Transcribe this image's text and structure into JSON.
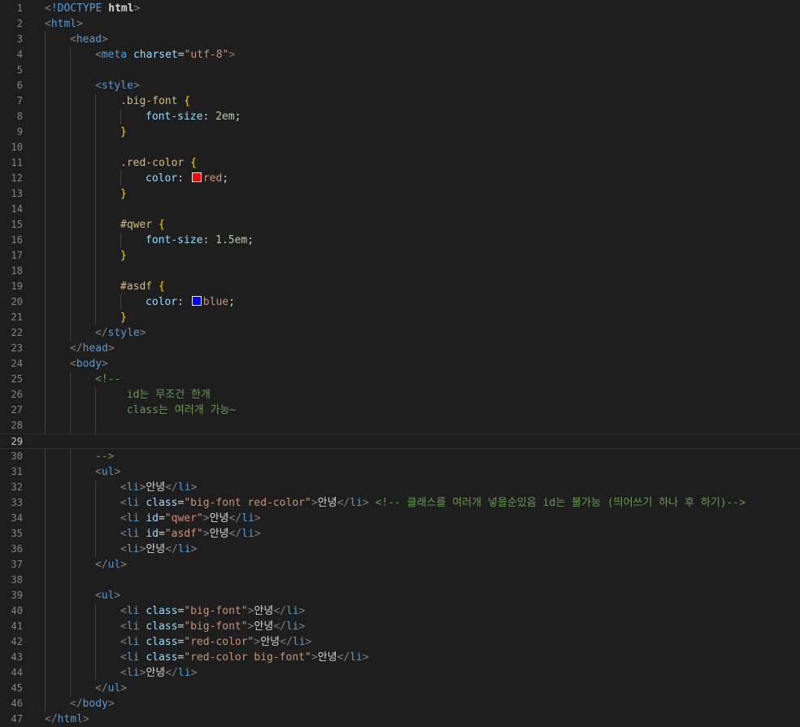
{
  "editor": {
    "current_line": 29,
    "colors": {
      "background": "#1e1e1e",
      "tag": "#569cd6",
      "attribute": "#9cdcfe",
      "string": "#ce9178",
      "comment": "#6a9955",
      "selector": "#d7ba7d",
      "brace": "#ffd700",
      "number": "#b5cea8",
      "swatch_red": "#ff0000",
      "swatch_blue": "#0000ff"
    },
    "lines": [
      {
        "n": "1",
        "indent": 0,
        "tokens": [
          [
            "punc",
            "<"
          ],
          [
            "tag",
            "!DOCTYPE "
          ],
          [
            "kw",
            "html"
          ],
          [
            "punc",
            ">"
          ]
        ]
      },
      {
        "n": "2",
        "indent": 0,
        "tokens": [
          [
            "punc",
            "<"
          ],
          [
            "tag",
            "html"
          ],
          [
            "punc",
            ">"
          ]
        ]
      },
      {
        "n": "3",
        "indent": 1,
        "tokens": [
          [
            "punc",
            "<"
          ],
          [
            "tag",
            "head"
          ],
          [
            "punc",
            ">"
          ]
        ]
      },
      {
        "n": "4",
        "indent": 2,
        "tokens": [
          [
            "punc",
            "<"
          ],
          [
            "tag",
            "meta "
          ],
          [
            "attr",
            "charset"
          ],
          [
            "text",
            "="
          ],
          [
            "str",
            "\"utf-8\""
          ],
          [
            "punc",
            ">"
          ]
        ]
      },
      {
        "n": "5",
        "indent": 2,
        "tokens": []
      },
      {
        "n": "6",
        "indent": 2,
        "tokens": [
          [
            "punc",
            "<"
          ],
          [
            "tag",
            "style"
          ],
          [
            "punc",
            ">"
          ]
        ]
      },
      {
        "n": "7",
        "indent": 3,
        "tokens": [
          [
            "sel",
            ".big-font "
          ],
          [
            "brace",
            "{"
          ]
        ]
      },
      {
        "n": "8",
        "indent": 4,
        "tokens": [
          [
            "prop",
            "font-size"
          ],
          [
            "text",
            ": "
          ],
          [
            "num",
            "2em"
          ],
          [
            "text",
            ";"
          ]
        ]
      },
      {
        "n": "9",
        "indent": 3,
        "tokens": [
          [
            "brace",
            "}"
          ]
        ]
      },
      {
        "n": "10",
        "indent": 3,
        "tokens": []
      },
      {
        "n": "11",
        "indent": 3,
        "tokens": [
          [
            "sel",
            ".red-color "
          ],
          [
            "brace",
            "{"
          ]
        ]
      },
      {
        "n": "12",
        "indent": 4,
        "tokens": [
          [
            "prop",
            "color"
          ],
          [
            "text",
            ": "
          ],
          [
            "swatch",
            "#ff0000"
          ],
          [
            "val",
            "red"
          ],
          [
            "text",
            ";"
          ]
        ]
      },
      {
        "n": "13",
        "indent": 3,
        "tokens": [
          [
            "brace",
            "}"
          ]
        ]
      },
      {
        "n": "14",
        "indent": 3,
        "tokens": []
      },
      {
        "n": "15",
        "indent": 3,
        "tokens": [
          [
            "sel",
            "#qwer "
          ],
          [
            "brace",
            "{"
          ]
        ]
      },
      {
        "n": "16",
        "indent": 4,
        "tokens": [
          [
            "prop",
            "font-size"
          ],
          [
            "text",
            ": "
          ],
          [
            "num",
            "1.5em"
          ],
          [
            "text",
            ";"
          ]
        ]
      },
      {
        "n": "17",
        "indent": 3,
        "tokens": [
          [
            "brace",
            "}"
          ]
        ]
      },
      {
        "n": "18",
        "indent": 3,
        "tokens": []
      },
      {
        "n": "19",
        "indent": 3,
        "tokens": [
          [
            "sel",
            "#asdf "
          ],
          [
            "brace",
            "{"
          ]
        ]
      },
      {
        "n": "20",
        "indent": 4,
        "tokens": [
          [
            "prop",
            "color"
          ],
          [
            "text",
            ": "
          ],
          [
            "swatch",
            "#0000ff"
          ],
          [
            "val",
            "blue"
          ],
          [
            "text",
            ";"
          ]
        ]
      },
      {
        "n": "21",
        "indent": 3,
        "tokens": [
          [
            "brace",
            "}"
          ]
        ]
      },
      {
        "n": "22",
        "indent": 2,
        "tokens": [
          [
            "punc",
            "</"
          ],
          [
            "tag",
            "style"
          ],
          [
            "punc",
            ">"
          ]
        ]
      },
      {
        "n": "23",
        "indent": 1,
        "tokens": [
          [
            "punc",
            "</"
          ],
          [
            "tag",
            "head"
          ],
          [
            "punc",
            ">"
          ]
        ]
      },
      {
        "n": "24",
        "indent": 1,
        "tokens": [
          [
            "punc",
            "<"
          ],
          [
            "tag",
            "body"
          ],
          [
            "punc",
            ">"
          ]
        ]
      },
      {
        "n": "25",
        "indent": 2,
        "tokens": [
          [
            "com",
            "<!--"
          ]
        ]
      },
      {
        "n": "26",
        "indent": 3,
        "tokens": [
          [
            "com",
            " id는 무조건 한개"
          ]
        ]
      },
      {
        "n": "27",
        "indent": 3,
        "tokens": [
          [
            "com",
            " class는 여러개 가능~"
          ]
        ]
      },
      {
        "n": "28",
        "indent": 3,
        "tokens": []
      },
      {
        "n": "29",
        "indent": 0,
        "tokens": []
      },
      {
        "n": "30",
        "indent": 2,
        "tokens": [
          [
            "com",
            "-->"
          ]
        ]
      },
      {
        "n": "31",
        "indent": 2,
        "tokens": [
          [
            "punc",
            "<"
          ],
          [
            "tag",
            "ul"
          ],
          [
            "punc",
            ">"
          ]
        ]
      },
      {
        "n": "32",
        "indent": 3,
        "tokens": [
          [
            "punc",
            "<"
          ],
          [
            "tag",
            "li"
          ],
          [
            "punc",
            ">"
          ],
          [
            "text",
            "안녕"
          ],
          [
            "punc",
            "</"
          ],
          [
            "tag",
            "li"
          ],
          [
            "punc",
            ">"
          ]
        ]
      },
      {
        "n": "33",
        "indent": 3,
        "tokens": [
          [
            "punc",
            "<"
          ],
          [
            "tag",
            "li "
          ],
          [
            "attr",
            "class"
          ],
          [
            "text",
            "="
          ],
          [
            "str",
            "\"big-font red-color\""
          ],
          [
            "punc",
            ">"
          ],
          [
            "text",
            "안녕"
          ],
          [
            "punc",
            "</"
          ],
          [
            "tag",
            "li"
          ],
          [
            "punc",
            "> "
          ],
          [
            "com",
            "<!-- 클래스를 여러개 넣을순있음 id는 불가능 (띄어쓰기 하나 후 하기)-->"
          ]
        ]
      },
      {
        "n": "34",
        "indent": 3,
        "tokens": [
          [
            "punc",
            "<"
          ],
          [
            "tag",
            "li "
          ],
          [
            "attr",
            "id"
          ],
          [
            "text",
            "="
          ],
          [
            "str",
            "\"qwer\""
          ],
          [
            "punc",
            ">"
          ],
          [
            "text",
            "안녕"
          ],
          [
            "punc",
            "</"
          ],
          [
            "tag",
            "li"
          ],
          [
            "punc",
            ">"
          ]
        ]
      },
      {
        "n": "35",
        "indent": 3,
        "tokens": [
          [
            "punc",
            "<"
          ],
          [
            "tag",
            "li "
          ],
          [
            "attr",
            "id"
          ],
          [
            "text",
            "="
          ],
          [
            "str",
            "\"asdf\""
          ],
          [
            "punc",
            ">"
          ],
          [
            "text",
            "안녕"
          ],
          [
            "punc",
            "</"
          ],
          [
            "tag",
            "li"
          ],
          [
            "punc",
            ">"
          ]
        ]
      },
      {
        "n": "36",
        "indent": 3,
        "tokens": [
          [
            "punc",
            "<"
          ],
          [
            "tag",
            "li"
          ],
          [
            "punc",
            ">"
          ],
          [
            "text",
            "안녕"
          ],
          [
            "punc",
            "</"
          ],
          [
            "tag",
            "li"
          ],
          [
            "punc",
            ">"
          ]
        ]
      },
      {
        "n": "37",
        "indent": 2,
        "tokens": [
          [
            "punc",
            "</"
          ],
          [
            "tag",
            "ul"
          ],
          [
            "punc",
            ">"
          ]
        ]
      },
      {
        "n": "38",
        "indent": 2,
        "tokens": []
      },
      {
        "n": "39",
        "indent": 2,
        "tokens": [
          [
            "punc",
            "<"
          ],
          [
            "tag",
            "ul"
          ],
          [
            "punc",
            ">"
          ]
        ]
      },
      {
        "n": "40",
        "indent": 3,
        "tokens": [
          [
            "punc",
            "<"
          ],
          [
            "tag",
            "li "
          ],
          [
            "attr",
            "class"
          ],
          [
            "text",
            "="
          ],
          [
            "str",
            "\"big-font\""
          ],
          [
            "punc",
            ">"
          ],
          [
            "text",
            "안녕"
          ],
          [
            "punc",
            "</"
          ],
          [
            "tag",
            "li"
          ],
          [
            "punc",
            ">"
          ]
        ]
      },
      {
        "n": "41",
        "indent": 3,
        "tokens": [
          [
            "punc",
            "<"
          ],
          [
            "tag",
            "li "
          ],
          [
            "attr",
            "class"
          ],
          [
            "text",
            "="
          ],
          [
            "str",
            "\"big-font\""
          ],
          [
            "punc",
            ">"
          ],
          [
            "text",
            "안녕"
          ],
          [
            "punc",
            "</"
          ],
          [
            "tag",
            "li"
          ],
          [
            "punc",
            ">"
          ]
        ]
      },
      {
        "n": "42",
        "indent": 3,
        "tokens": [
          [
            "punc",
            "<"
          ],
          [
            "tag",
            "li "
          ],
          [
            "attr",
            "class"
          ],
          [
            "text",
            "="
          ],
          [
            "str",
            "\"red-color\""
          ],
          [
            "punc",
            ">"
          ],
          [
            "text",
            "안녕"
          ],
          [
            "punc",
            "</"
          ],
          [
            "tag",
            "li"
          ],
          [
            "punc",
            ">"
          ]
        ]
      },
      {
        "n": "43",
        "indent": 3,
        "tokens": [
          [
            "punc",
            "<"
          ],
          [
            "tag",
            "li "
          ],
          [
            "attr",
            "class"
          ],
          [
            "text",
            "="
          ],
          [
            "str",
            "\"red-color big-font\""
          ],
          [
            "punc",
            ">"
          ],
          [
            "text",
            "안녕"
          ],
          [
            "punc",
            "</"
          ],
          [
            "tag",
            "li"
          ],
          [
            "punc",
            ">"
          ]
        ]
      },
      {
        "n": "44",
        "indent": 3,
        "tokens": [
          [
            "punc",
            "<"
          ],
          [
            "tag",
            "li"
          ],
          [
            "punc",
            ">"
          ],
          [
            "text",
            "안녕"
          ],
          [
            "punc",
            "</"
          ],
          [
            "tag",
            "li"
          ],
          [
            "punc",
            ">"
          ]
        ]
      },
      {
        "n": "45",
        "indent": 2,
        "tokens": [
          [
            "punc",
            "</"
          ],
          [
            "tag",
            "ul"
          ],
          [
            "punc",
            ">"
          ]
        ]
      },
      {
        "n": "46",
        "indent": 1,
        "tokens": [
          [
            "punc",
            "</"
          ],
          [
            "tag",
            "body"
          ],
          [
            "punc",
            ">"
          ]
        ]
      },
      {
        "n": "47",
        "indent": 0,
        "tokens": [
          [
            "punc",
            "</"
          ],
          [
            "tag",
            "html"
          ],
          [
            "punc",
            ">"
          ]
        ]
      }
    ]
  }
}
